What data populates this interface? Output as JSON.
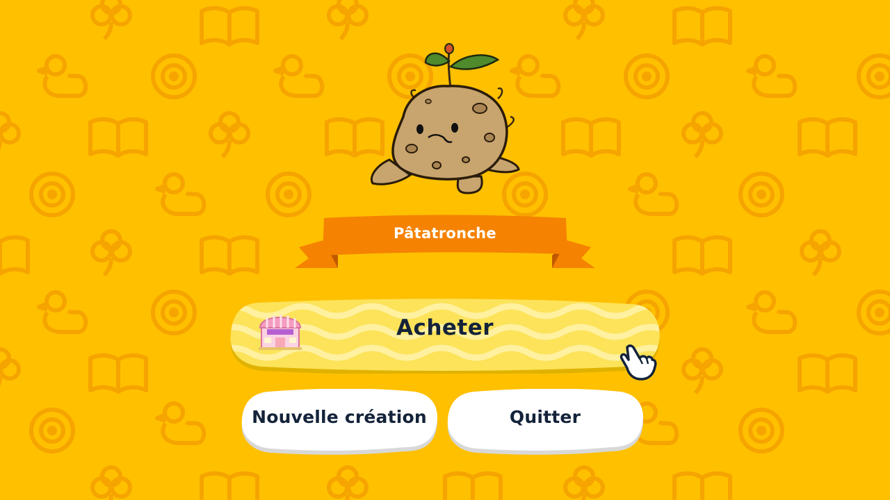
{
  "colors": {
    "background": "#ffc000",
    "pattern": "#f5a400",
    "ribbon": "#f58200",
    "ribbon_dark": "#d96500",
    "button_primary": "#fce35a",
    "text_dark": "#14233a"
  },
  "character": {
    "icon": "potato-creature"
  },
  "banner": {
    "name": "Pâtatronche"
  },
  "buttons": {
    "buy": {
      "label": "Acheter",
      "icon": "shop-icon"
    },
    "new_creation": {
      "label": "Nouvelle création"
    },
    "quit": {
      "label": "Quitter"
    }
  },
  "cursor": {
    "icon": "pointing-hand-icon"
  }
}
